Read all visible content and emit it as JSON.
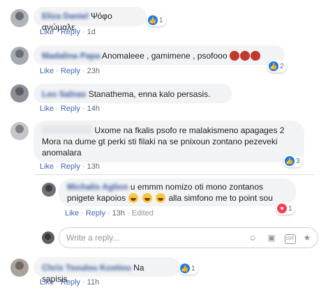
{
  "comments": [
    {
      "author": "Eliza Daniel",
      "text": "Ψόφο ανώμαλε",
      "like_label": "Like",
      "reply_label": "Reply",
      "time": "1d",
      "reaction_count": "1"
    },
    {
      "author": "Madalina Papa",
      "text": "Anomaleee , gamimene , psofooo",
      "like_label": "Like",
      "reply_label": "Reply",
      "time": "23h",
      "reaction_count": "2"
    },
    {
      "author": "Leo Salnas",
      "text": "Stanathema, enna kalo persasis.",
      "like_label": "Like",
      "reply_label": "Reply",
      "time": "14h"
    },
    {
      "author": "",
      "text_line1": "Uxome na fkalis psofo re malakismeno apagages 2",
      "text_line2": "Mora na dume gt perki sti filaki na se pnixoun zontano pezeveki",
      "text_line3": "anomalara",
      "like_label": "Like",
      "reply_label": "Reply",
      "time": "13h",
      "reaction_count": "3"
    }
  ],
  "reply": {
    "author": "Michalis Aglion",
    "text_line1": "u emmm nomizo oti mono zontanos",
    "text_line2_a": "pnigete kapoios",
    "text_line2_b": "alla simfono me to point sou",
    "like_label": "Like",
    "reply_label": "Reply",
    "time": "13h",
    "edited": "Edited",
    "reaction_count": "1"
  },
  "reply_input": {
    "placeholder": "Write a reply..."
  },
  "last_comment": {
    "author": "Chris Tsoulou Kostiou",
    "text": "Na sapisis",
    "like_label": "Like",
    "reply_label": "Reply",
    "time": "11h",
    "reaction_count": "1"
  }
}
